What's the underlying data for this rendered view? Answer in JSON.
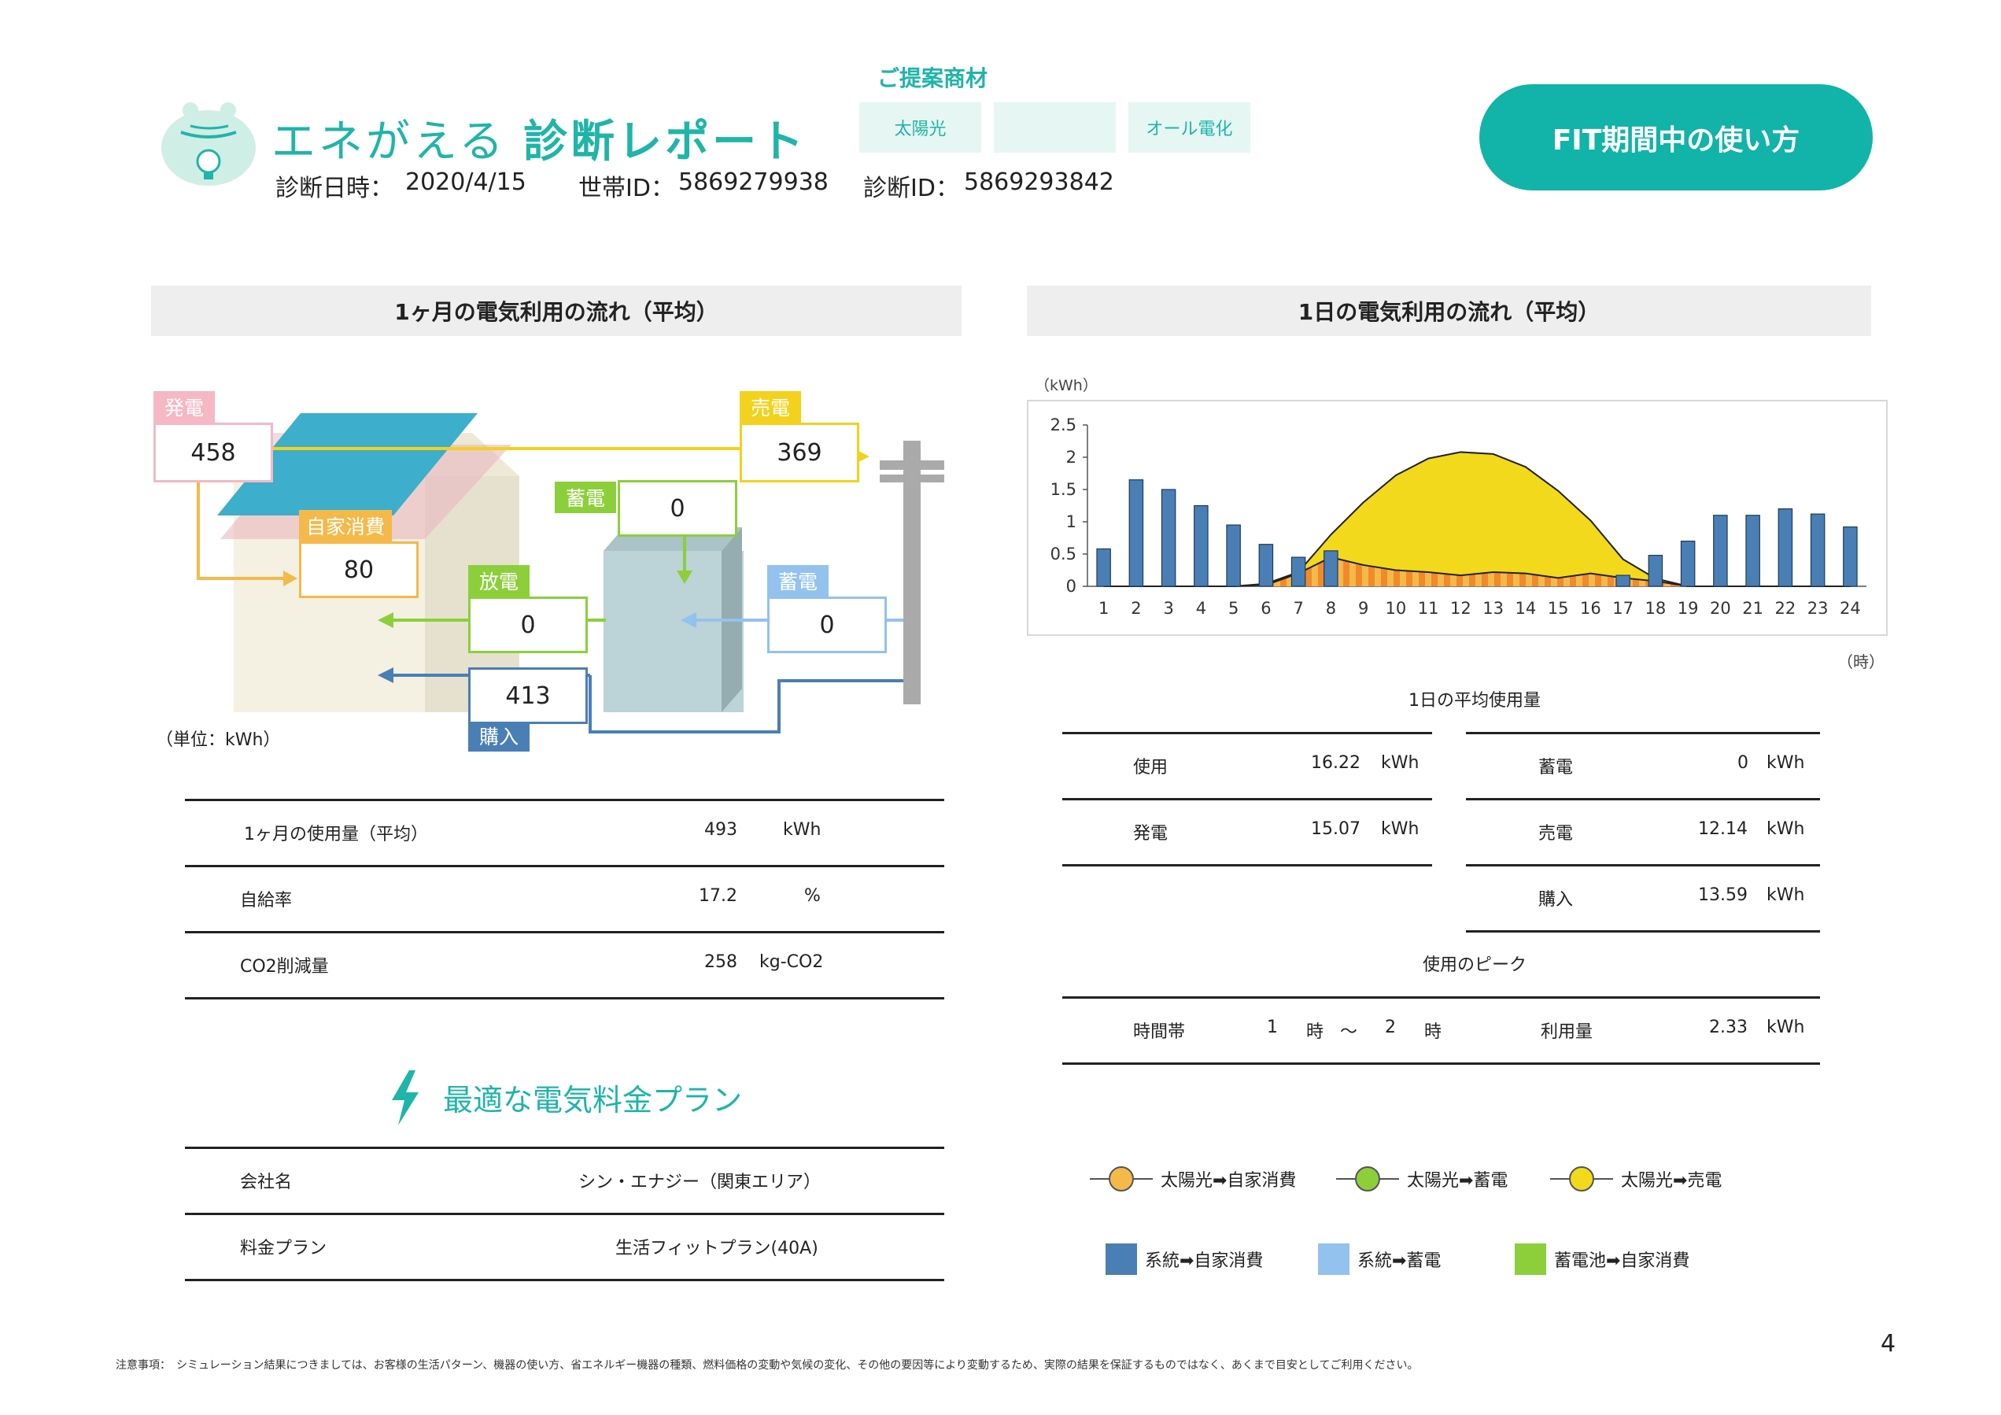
{
  "header": {
    "title_light": "エネがえる",
    "title_bold": "診断レポート",
    "diag_date_label": "診断日時：",
    "diag_date": "2020/4/15",
    "household_label": "世帯ID：",
    "household_id": "5869279938",
    "diag_id_label": "診断ID：",
    "diag_id": "5869293842"
  },
  "proposal": {
    "title": "ご提案商材",
    "items": [
      "太陽光",
      "",
      "オール電化"
    ]
  },
  "fit_button": "FIT期間中の使い方",
  "monthly": {
    "heading": "1ヶ月の電気利用の流れ（平均）",
    "tags": {
      "generation": "発電",
      "sell": "売電",
      "self_use": "自家消費",
      "store_in": "蓄電",
      "discharge": "放電",
      "grid_store": "蓄電",
      "purchase": "購入"
    },
    "values": {
      "generation": "458",
      "sell": "369",
      "self_use": "80",
      "store_in": "0",
      "discharge": "0",
      "grid_store": "0",
      "purchase": "413"
    },
    "unit_note": "（単位：kWh）",
    "table": [
      {
        "label": "1ヶ月の使用量（平均）",
        "value": "493",
        "unit": "kWh"
      },
      {
        "label": "自給率",
        "value": "17.2",
        "unit": "%"
      },
      {
        "label": "CO2削減量",
        "value": "258",
        "unit": "kg-CO2"
      }
    ]
  },
  "plan": {
    "heading": "最適な電気料金プラン",
    "rows": [
      {
        "label": "会社名",
        "value": "シン・エナジー（関東エリア）"
      },
      {
        "label": "料金プラン",
        "value": "生活フィットプラン(40A)"
      }
    ]
  },
  "daily": {
    "heading": "1日の電気利用の流れ（平均）",
    "y_unit": "（kWh）",
    "x_unit": "（時）",
    "avg_title": "1日の平均使用量",
    "left_rows": [
      {
        "label": "使用",
        "value": "16.22",
        "unit": "kWh"
      },
      {
        "label": "発電",
        "value": "15.07",
        "unit": "kWh"
      }
    ],
    "right_rows": [
      {
        "label": "蓄電",
        "value": "0",
        "unit": "kWh"
      },
      {
        "label": "売電",
        "value": "12.14",
        "unit": "kWh"
      },
      {
        "label": "購入",
        "value": "13.59",
        "unit": "kWh"
      }
    ],
    "peak_title": "使用のピーク",
    "peak": {
      "band_label": "時間帯",
      "from": "1",
      "from_unit": "時",
      "tilde": "～",
      "to": "2",
      "to_unit": "時",
      "amount_label": "利用量",
      "amount": "2.33",
      "amount_unit": "kWh"
    },
    "legend": {
      "solar_self": "太陽光➡自家消費",
      "solar_store": "太陽光➡蓄電",
      "solar_sell": "太陽光➡売電",
      "grid_self": "系統➡自家消費",
      "grid_store": "系統➡蓄電",
      "battery_self": "蓄電池➡自家消費"
    }
  },
  "chart_data": {
    "type": "bar",
    "categories": [
      "1",
      "2",
      "3",
      "4",
      "5",
      "6",
      "7",
      "8",
      "9",
      "10",
      "11",
      "12",
      "13",
      "14",
      "15",
      "16",
      "17",
      "18",
      "19",
      "20",
      "21",
      "22",
      "23",
      "24"
    ],
    "ylim": [
      0,
      2.5
    ],
    "yticks": [
      "0",
      "0.5",
      "1",
      "1.5",
      "2",
      "2.5"
    ],
    "series": [
      {
        "name": "系統➡自家消費",
        "type": "bar",
        "color": "#4a7fb5",
        "values": [
          0.58,
          1.65,
          1.5,
          1.25,
          0.95,
          0.65,
          0.45,
          0.55,
          0,
          0,
          0,
          0,
          0,
          0,
          0,
          0,
          0.17,
          0.48,
          0.7,
          1.1,
          1.1,
          1.2,
          1.12,
          0.92
        ]
      },
      {
        "name": "太陽光➡自家消費",
        "type": "area",
        "color": "#f5a623",
        "values": [
          0,
          0,
          0,
          0,
          0,
          0.02,
          0.2,
          0.45,
          0.33,
          0.25,
          0.22,
          0.17,
          0.22,
          0.2,
          0.13,
          0.2,
          0.13,
          0.08,
          0,
          0,
          0,
          0,
          0,
          0
        ]
      },
      {
        "name": "太陽光➡売電",
        "type": "area",
        "color": "#f2d91c",
        "values": [
          0,
          0,
          0,
          0,
          0,
          0.04,
          0.22,
          0.8,
          1.3,
          1.72,
          1.98,
          2.08,
          2.05,
          1.85,
          1.48,
          1.02,
          0.42,
          0.12,
          0,
          0,
          0,
          0,
          0,
          0
        ]
      }
    ],
    "x_unit": "（時）",
    "y_unit": "（kWh）"
  },
  "footnote": "注意事項：　シミュレーション結果につきましては、お客様の生活パターン、機器の使い方、省エネルギー機器の種類、燃料価格の変動や気候の変化、その他の要因等により変動するため、実際の結果を保証するものではなく、あくまで目安としてご利用ください。",
  "page_number": "4"
}
